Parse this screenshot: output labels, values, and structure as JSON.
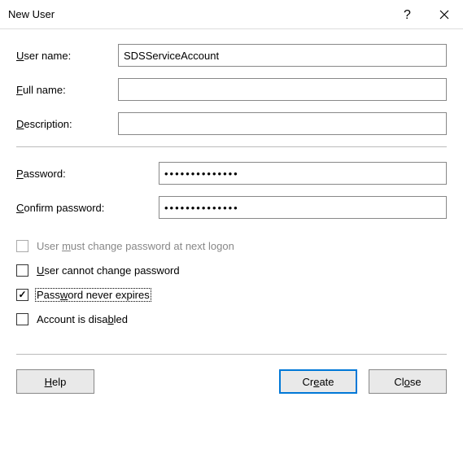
{
  "titlebar": {
    "title": "New User"
  },
  "labels": {
    "username_pre": "",
    "username_u": "U",
    "username_post": "ser name:",
    "fullname_u": "F",
    "fullname_post": "ull name:",
    "description_u": "D",
    "description_post": "escription:",
    "password_u": "P",
    "password_post": "assword:",
    "confirm_pre": "",
    "confirm_u": "C",
    "confirm_post": "onfirm password:"
  },
  "fields": {
    "username": "SDSServiceAccount",
    "fullname": "",
    "description": "",
    "password": "••••••••••••••",
    "confirm": "••••••••••••••"
  },
  "checks": {
    "must_change_pre": "User ",
    "must_change_u": "m",
    "must_change_post": "ust change password at next logon",
    "cannot_change_pre": "",
    "cannot_change_u": "U",
    "cannot_change_post": "ser cannot change password",
    "never_expires_pre": "Pass",
    "never_expires_u": "w",
    "never_expires_post": "ord never expires",
    "disabled_pre": "Account is disa",
    "disabled_u": "b",
    "disabled_post": "led"
  },
  "buttons": {
    "help_u": "H",
    "help_post": "elp",
    "create_pre": "Cr",
    "create_u": "e",
    "create_post": "ate",
    "close_pre": "Cl",
    "close_u": "o",
    "close_post": "se"
  }
}
